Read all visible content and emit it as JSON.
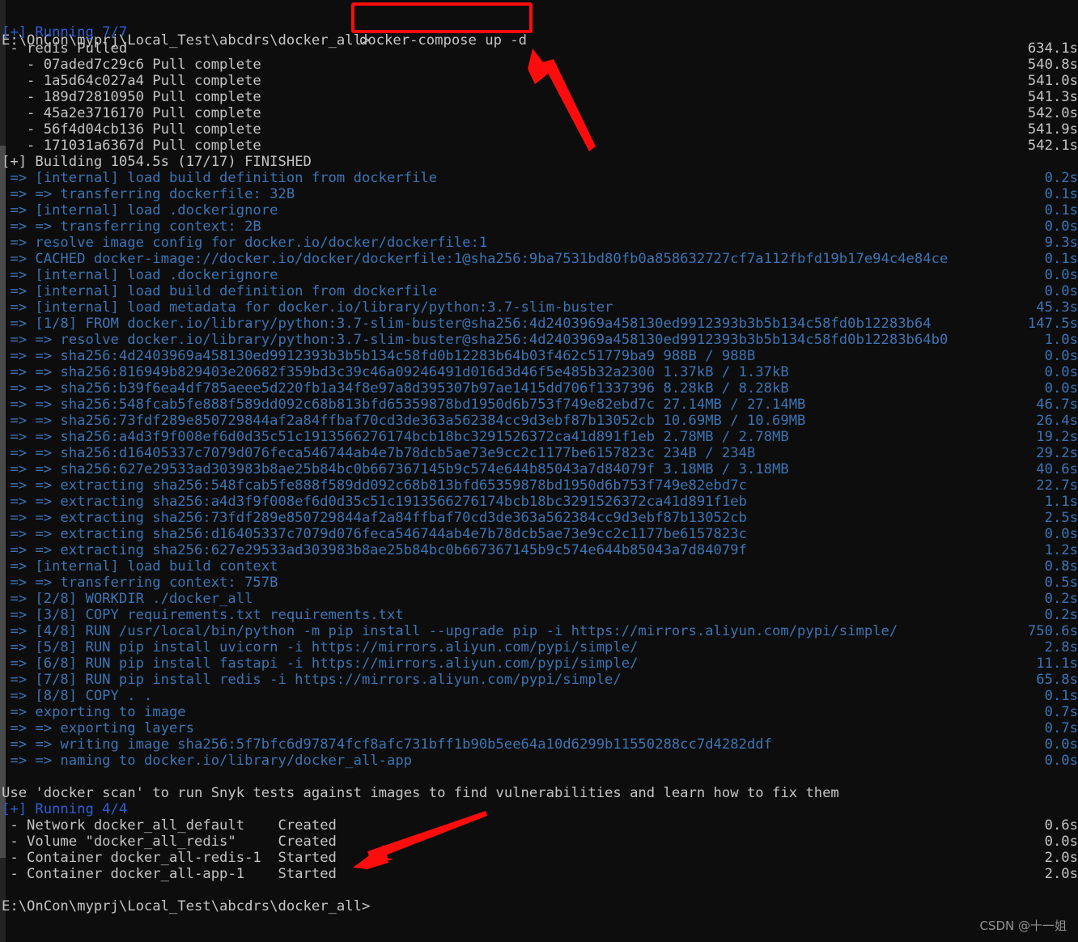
{
  "terminal": {
    "prompt_top": "E:\\OnCon\\myprj\\Local_Test\\abcdrs\\docker_all>",
    "command": "docker-compose up -d",
    "prompt_bottom": "E:\\OnCon\\myprj\\Local_Test\\abcdrs\\docker_all>",
    "colors": {
      "background": "#0d0d0d",
      "default_text": "#cccccc",
      "running_blue": "#2c5fd6",
      "build_blue": "#3b74b5",
      "annotation_red": "#fc0d0d"
    },
    "lines": [
      {
        "text": "[+] Running 7/7",
        "color": "c-blue",
        "time": ""
      },
      {
        "text": " - redis Pulled",
        "color": "c-gray",
        "time": "634.1s"
      },
      {
        "text": "   - 07aded7c29c6 Pull complete",
        "color": "c-gray",
        "time": "540.8s"
      },
      {
        "text": "   - 1a5d64c027a4 Pull complete",
        "color": "c-gray",
        "time": "541.0s"
      },
      {
        "text": "   - 189d72810950 Pull complete",
        "color": "c-gray",
        "time": "541.3s"
      },
      {
        "text": "   - 45a2e3716170 Pull complete",
        "color": "c-gray",
        "time": "542.0s"
      },
      {
        "text": "   - 56f4d04cb136 Pull complete",
        "color": "c-gray",
        "time": "541.9s"
      },
      {
        "text": "   - 171031a6367d Pull complete",
        "color": "c-gray",
        "time": "542.1s"
      },
      {
        "text": "[+] Building 1054.5s (17/17) FINISHED",
        "color": "c-gray",
        "time": ""
      },
      {
        "text": " => [internal] load build definition from dockerfile",
        "color": "c-steel",
        "time": "0.2s"
      },
      {
        "text": " => => transferring dockerfile: 32B",
        "color": "c-steel",
        "time": "0.1s"
      },
      {
        "text": " => [internal] load .dockerignore",
        "color": "c-steel",
        "time": "0.1s"
      },
      {
        "text": " => => transferring context: 2B",
        "color": "c-steel",
        "time": "0.0s"
      },
      {
        "text": " => resolve image config for docker.io/docker/dockerfile:1",
        "color": "c-steel",
        "time": "9.3s"
      },
      {
        "text": " => CACHED docker-image://docker.io/docker/dockerfile:1@sha256:9ba7531bd80fb0a858632727cf7a112fbfd19b17e94c4e84ce",
        "color": "c-steel",
        "time": "0.1s"
      },
      {
        "text": " => [internal] load .dockerignore",
        "color": "c-steel",
        "time": "0.0s"
      },
      {
        "text": " => [internal] load build definition from dockerfile",
        "color": "c-steel",
        "time": "0.0s"
      },
      {
        "text": " => [internal] load metadata for docker.io/library/python:3.7-slim-buster",
        "color": "c-steel",
        "time": "45.3s"
      },
      {
        "text": " => [1/8] FROM docker.io/library/python:3.7-slim-buster@sha256:4d2403969a458130ed9912393b3b5b134c58fd0b12283b64",
        "color": "c-steel",
        "time": "147.5s"
      },
      {
        "text": " => => resolve docker.io/library/python:3.7-slim-buster@sha256:4d2403969a458130ed9912393b3b5b134c58fd0b12283b64b0",
        "color": "c-steel",
        "time": "1.0s"
      },
      {
        "text": " => => sha256:4d2403969a458130ed9912393b3b5b134c58fd0b12283b64b03f462c51779ba9 988B / 988B",
        "color": "c-steel",
        "time": "0.0s"
      },
      {
        "text": " => => sha256:816949b829403e20682f359bd3c39c46a09246491d016d3d46f5e485b32a2300 1.37kB / 1.37kB",
        "color": "c-steel",
        "time": "0.0s"
      },
      {
        "text": " => => sha256:b39f6ea4df785aeee5d220fb1a34f8e97a8d395307b97ae1415dd706f1337396 8.28kB / 8.28kB",
        "color": "c-steel",
        "time": "0.0s"
      },
      {
        "text": " => => sha256:548fcab5fe888f589dd092c68b813bfd65359878bd1950d6b753f749e82ebd7c 27.14MB / 27.14MB",
        "color": "c-steel",
        "time": "46.7s"
      },
      {
        "text": " => => sha256:73fdf289e850729844af2a84ffbaf70cd3de363a562384cc9d3ebf87b13052cb 10.69MB / 10.69MB",
        "color": "c-steel",
        "time": "26.4s"
      },
      {
        "text": " => => sha256:a4d3f9f008ef6d0d35c51c1913566276174bcb18bc3291526372ca41d891f1eb 2.78MB / 2.78MB",
        "color": "c-steel",
        "time": "19.2s"
      },
      {
        "text": " => => sha256:d16405337c7079d076feca546744ab4e7b78dcb5ae73e9cc2c1177be6157823c 234B / 234B",
        "color": "c-steel",
        "time": "29.2s"
      },
      {
        "text": " => => sha256:627e29533ad303983b8ae25b84bc0b667367145b9c574e644b85043a7d84079f 3.18MB / 3.18MB",
        "color": "c-steel",
        "time": "40.6s"
      },
      {
        "text": " => => extracting sha256:548fcab5fe888f589dd092c68b813bfd65359878bd1950d6b753f749e82ebd7c",
        "color": "c-steel",
        "time": "22.7s"
      },
      {
        "text": " => => extracting sha256:a4d3f9f008ef6d0d35c51c1913566276174bcb18bc3291526372ca41d891f1eb",
        "color": "c-steel",
        "time": "1.1s"
      },
      {
        "text": " => => extracting sha256:73fdf289e850729844af2a84ffbaf70cd3de363a562384cc9d3ebf87b13052cb",
        "color": "c-steel",
        "time": "2.5s"
      },
      {
        "text": " => => extracting sha256:d16405337c7079d076feca546744ab4e7b78dcb5ae73e9cc2c1177be6157823c",
        "color": "c-steel",
        "time": "0.0s"
      },
      {
        "text": " => => extracting sha256:627e29533ad303983b8ae25b84bc0b667367145b9c574e644b85043a7d84079f",
        "color": "c-steel",
        "time": "1.2s"
      },
      {
        "text": " => [internal] load build context",
        "color": "c-steel",
        "time": "0.8s"
      },
      {
        "text": " => => transferring context: 757B",
        "color": "c-steel",
        "time": "0.5s"
      },
      {
        "text": " => [2/8] WORKDIR ./docker_all",
        "color": "c-steel",
        "time": "0.2s"
      },
      {
        "text": " => [3/8] COPY requirements.txt requirements.txt",
        "color": "c-steel",
        "time": "0.2s"
      },
      {
        "text": " => [4/8] RUN /usr/local/bin/python -m pip install --upgrade pip -i https://mirrors.aliyun.com/pypi/simple/",
        "color": "c-steel",
        "time": "750.6s"
      },
      {
        "text": " => [5/8] RUN pip install uvicorn -i https://mirrors.aliyun.com/pypi/simple/",
        "color": "c-steel",
        "time": "2.8s"
      },
      {
        "text": " => [6/8] RUN pip install fastapi -i https://mirrors.aliyun.com/pypi/simple/",
        "color": "c-steel",
        "time": "11.1s"
      },
      {
        "text": " => [7/8] RUN pip install redis -i https://mirrors.aliyun.com/pypi/simple/",
        "color": "c-steel",
        "time": "65.8s"
      },
      {
        "text": " => [8/8] COPY . .",
        "color": "c-steel",
        "time": "0.1s"
      },
      {
        "text": " => exporting to image",
        "color": "c-steel",
        "time": "0.7s"
      },
      {
        "text": " => => exporting layers",
        "color": "c-steel",
        "time": "0.7s"
      },
      {
        "text": " => => writing image sha256:5f7bfc6d97874fcf8afc731bff1b90b5ee64a10d6299b11550288cc7d4282ddf",
        "color": "c-steel",
        "time": "0.0s"
      },
      {
        "text": " => => naming to docker.io/library/docker_all-app",
        "color": "c-steel",
        "time": "0.0s"
      },
      {
        "text": "",
        "color": "c-gray",
        "time": ""
      },
      {
        "text": "Use 'docker scan' to run Snyk tests against images to find vulnerabilities and learn how to fix them",
        "color": "c-gray",
        "time": ""
      },
      {
        "text": "[+] Running 4/4",
        "color": "c-blue",
        "time": ""
      },
      {
        "text": " - Network docker_all_default    Created",
        "color": "c-gray",
        "time": "0.6s"
      },
      {
        "text": " - Volume \"docker_all_redis\"     Created",
        "color": "c-gray",
        "time": "0.0s"
      },
      {
        "text": " - Container docker_all-redis-1  Started",
        "color": "c-gray",
        "time": "2.0s"
      },
      {
        "text": " - Container docker_all-app-1    Started",
        "color": "c-gray",
        "time": "2.0s"
      },
      {
        "text": "",
        "color": "c-gray",
        "time": ""
      },
      {
        "text": "E:\\OnCon\\myprj\\Local_Test\\abcdrs\\docker_all>",
        "color": "c-gray",
        "time": ""
      }
    ]
  },
  "annotations": {
    "highlight_box_label": "docker-compose up -d",
    "arrow_top_label": "points-to-command",
    "arrow_bottom_label": "points-to-started-containers"
  },
  "watermark": {
    "text": "CSDN @十一姐"
  }
}
